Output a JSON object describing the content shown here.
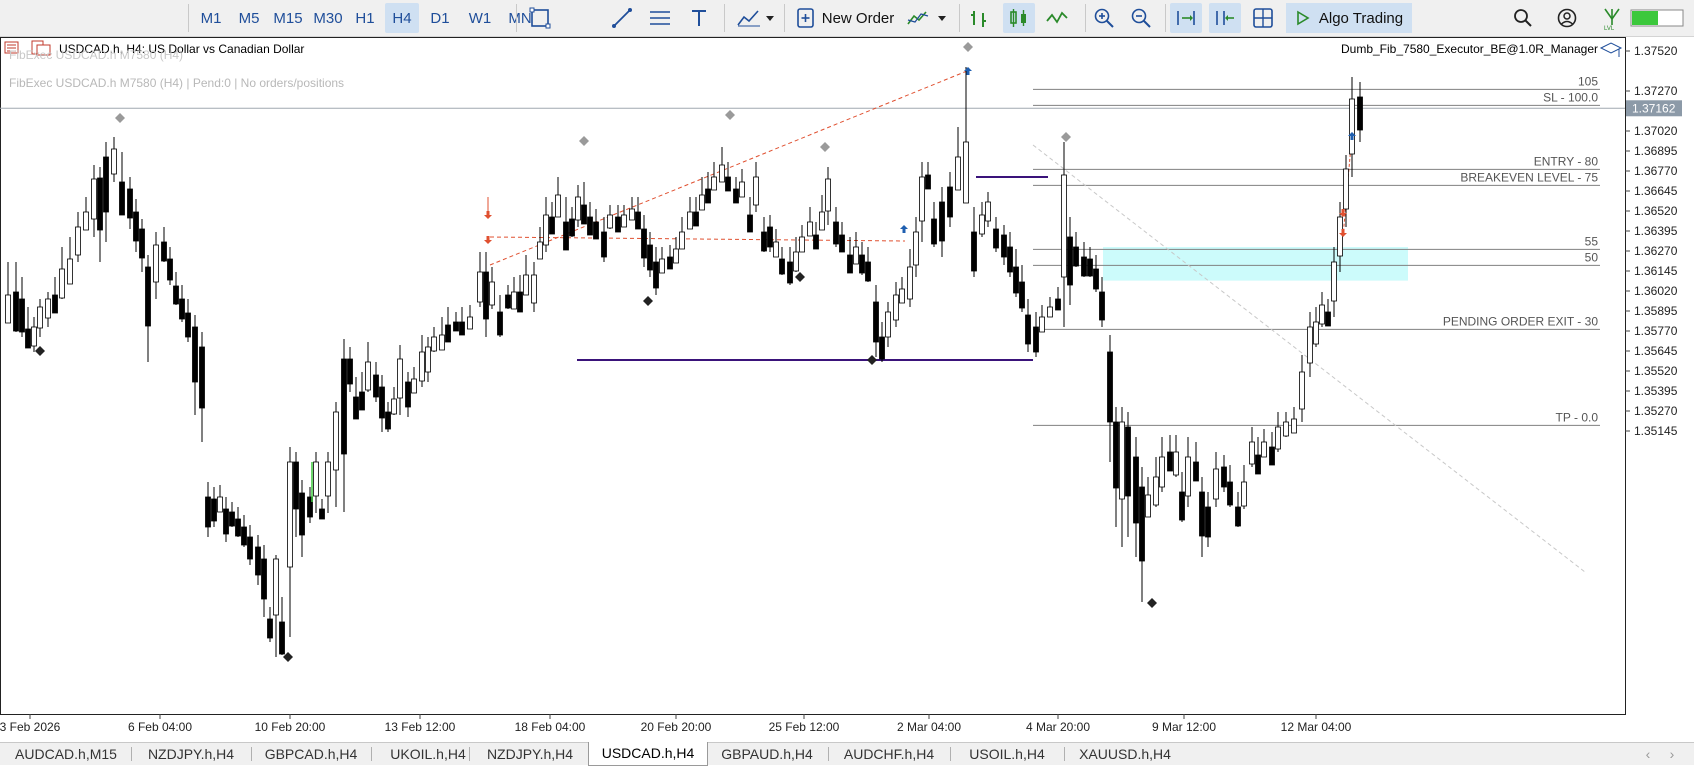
{
  "toolbar": {
    "timeframes": [
      "M1",
      "M5",
      "M15",
      "M30",
      "H1",
      "H4",
      "D1",
      "W1",
      "MN"
    ],
    "active_timeframe": "H4",
    "new_order_label": "New Order",
    "algo_trading_label": "Algo Trading",
    "icons": [
      "crosshair-icon",
      "line-icon",
      "fibonacci-icon",
      "text-icon",
      "indicators-icon",
      "new-order-icon",
      "chart-type-icon",
      "bar-chart-icon",
      "candlestick-icon",
      "line-chart-icon",
      "zoom-in-icon",
      "zoom-out-icon",
      "autoscroll-icon",
      "chart-shift-icon",
      "grid-icon",
      "search-icon",
      "account-icon",
      "signal-icon"
    ],
    "accent_color": "#1f4e9a",
    "active_bg": "#cfe0f2",
    "signal_bar_color": "#3cc83c"
  },
  "chart": {
    "symbol_title": "USDCAD.h,  H4:  US Dollar vs Canadian Dollar",
    "faded_title": "FibExec USDCAD.h M7580 (H4)",
    "ea_status": "FibExec USDCAD.h M7580 (H4) | Pend:0 | No orders/positions",
    "expert_name": "Dumb_Fib_7580_Executor_BE@1.0R_Manager",
    "current_price": "1.37162",
    "price_ticks": [
      "1.37520",
      "1.37270",
      "1.37020",
      "1.36895",
      "1.36770",
      "1.36645",
      "1.36520",
      "1.36395",
      "1.36270",
      "1.36145",
      "1.36020",
      "1.35895",
      "1.35770",
      "1.35645",
      "1.35520",
      "1.35395",
      "1.35270",
      "1.35145"
    ],
    "time_ticks": [
      "3 Feb 2026",
      "6 Feb 04:00",
      "10 Feb 20:00",
      "13 Feb 12:00",
      "18 Feb 04:00",
      "20 Feb 20:00",
      "25 Feb 12:00",
      "2 Mar 04:00",
      "4 Mar 20:00",
      "9 Mar 12:00",
      "12 Mar 04:00"
    ],
    "fib_levels": [
      {
        "label": "105",
        "price": 1.3728
      },
      {
        "label": "SL - 100.0",
        "price": 1.3718
      },
      {
        "label": "ENTRY - 80",
        "price": 1.3678
      },
      {
        "label": "BREAKEVEN LEVEL - 75",
        "price": 1.3668
      },
      {
        "label": "55",
        "price": 1.3628
      },
      {
        "label": "50",
        "price": 1.3618
      },
      {
        "label": "PENDING ORDER EXIT - 30",
        "price": 1.3578
      },
      {
        "label": "TP - 0.0",
        "price": 1.3518
      }
    ],
    "price_line": 1.37162,
    "up_color": "#ffffff",
    "down_color": "#000000",
    "zone_color": "#ccfbfb",
    "level_line_color": "#808080",
    "trend_line_color": "#e05030",
    "purple_line_color": "#3a137a"
  },
  "tabs": {
    "items": [
      "AUDCAD.h,M15",
      "NZDJPY.h,H4",
      "GBPCAD.h,H4",
      "UKOIL.h,H4",
      "NZDJPY.h,H4",
      "USDCAD.h,H4",
      "GBPAUD.h,H4",
      "AUDCHF.h,H4",
      "USOIL.h,H4",
      "XAUUSD.h,H4"
    ],
    "selected": "USDCAD.h,H4"
  }
}
